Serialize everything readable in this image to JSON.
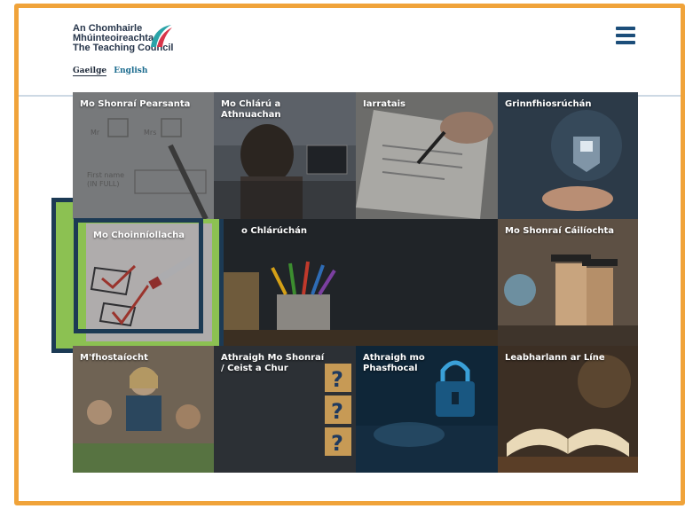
{
  "header": {
    "logo_line1": "An Chomhairle",
    "logo_line2": "Mhúinteoireachta",
    "logo_line3": "The Teaching Council",
    "lang_ga": "Gaeilge",
    "lang_en": "English"
  },
  "tiles": [
    {
      "label": "Mo Shonraí Pearsanta",
      "image": "personal-details-form"
    },
    {
      "label": "Mo Chlárú a Athnuachan",
      "image": "student-at-laptop"
    },
    {
      "label": "Iarratais",
      "image": "signing-document"
    },
    {
      "label": "Grinnfhiosrúchán",
      "image": "security-lock-hand"
    },
    {
      "label": "Mo Choinníollacha",
      "image": "checklist-pen"
    },
    {
      "label": "o Chlárúchán",
      "image": "desk-pencils"
    },
    {
      "label": "Mo Shonraí Cáilíochta",
      "image": "graduates-globe"
    },
    {
      "label": "M'fhostaíocht",
      "image": "teacher-children"
    },
    {
      "label": "Athraigh Mo Shonraí / Ceist a Chur",
      "image": "question-blocks"
    },
    {
      "label": "Athraigh mo Phasfhocal",
      "image": "padlock-keyboard"
    },
    {
      "label": "Leabharlann ar Líne",
      "image": "open-book"
    }
  ],
  "highlight_color": "#8cc152",
  "frame_color": "#f0a33a",
  "accent_color": "#1c4e7a"
}
